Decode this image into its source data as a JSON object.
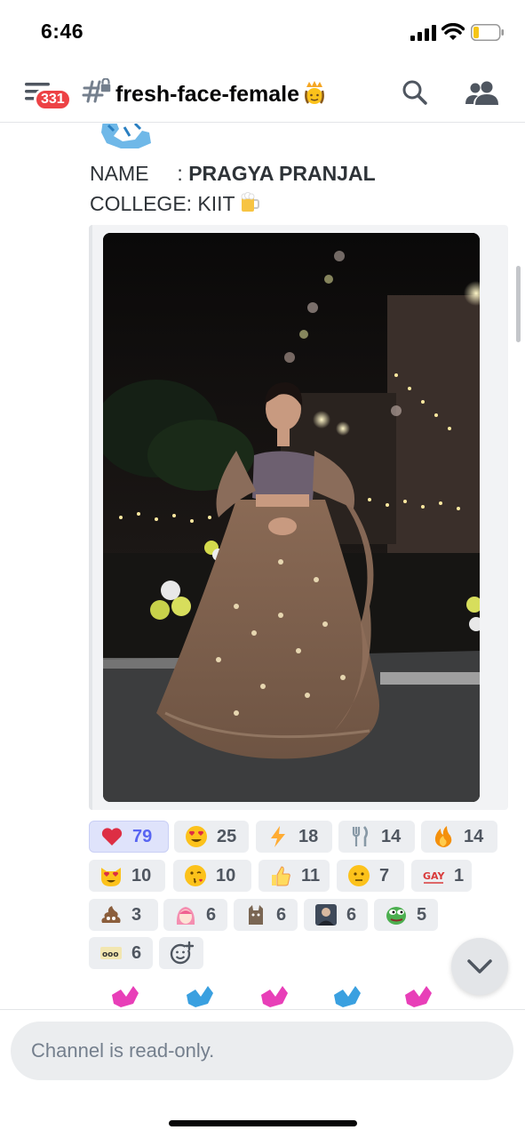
{
  "status_bar": {
    "time": "6:46"
  },
  "header": {
    "mention_count": "331",
    "channel_name": "fresh-face-female",
    "icons": [
      "hamburger-icon",
      "channel-lock-icon",
      "crown-emoji",
      "search-icon",
      "members-icon"
    ]
  },
  "message": {
    "name_label": "NAME     : ",
    "name_value": "PRAGYA PRANJAL",
    "college_line": "COLLEGE: KIIT",
    "college_emoji": "beer-mug-emoji"
  },
  "reactions": [
    {
      "emoji": "red-heart",
      "count": "79",
      "me": true
    },
    {
      "emoji": "heart-eyes",
      "count": "25"
    },
    {
      "emoji": "lightning",
      "count": "18"
    },
    {
      "emoji": "fork-knife",
      "count": "14"
    },
    {
      "emoji": "fire",
      "count": "14"
    },
    {
      "emoji": "heart-eyes-cat",
      "count": "10"
    },
    {
      "emoji": "face-blowing-kiss",
      "count": "10"
    },
    {
      "emoji": "thumbs-up",
      "count": "11"
    },
    {
      "emoji": "neutral-face",
      "count": "7"
    },
    {
      "emoji": "gay-sticker",
      "count": "1"
    },
    {
      "emoji": "pile-of-poo",
      "count": "3"
    },
    {
      "emoji": "anime-girl",
      "count": "6"
    },
    {
      "emoji": "cat-custom",
      "count": "6"
    },
    {
      "emoji": "person-photo",
      "count": "6"
    },
    {
      "emoji": "pepe-custom",
      "count": "5"
    },
    {
      "emoji": "ooo-custom",
      "count": "6"
    }
  ],
  "input": {
    "placeholder": "Channel is read-only."
  },
  "colors": {
    "accent": "#5865f2",
    "badge": "#ed4245",
    "chip": "#eceef1"
  }
}
